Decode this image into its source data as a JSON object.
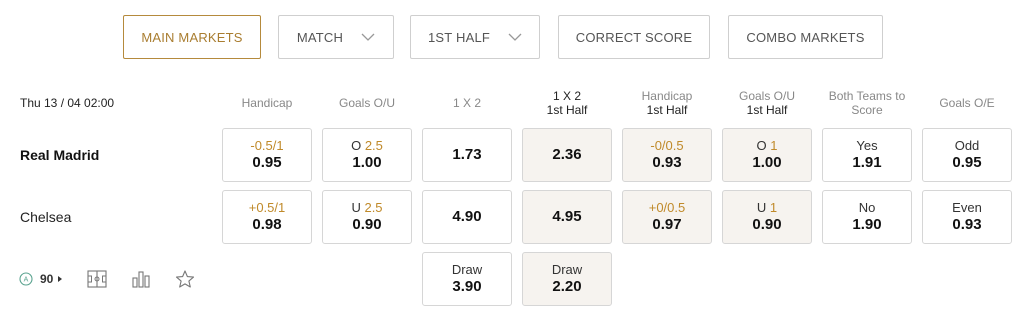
{
  "tabs": [
    {
      "label": "MAIN MARKETS",
      "active": true,
      "dropdown": false
    },
    {
      "label": "MATCH",
      "active": false,
      "dropdown": true
    },
    {
      "label": "1ST HALF",
      "active": false,
      "dropdown": true
    },
    {
      "label": "CORRECT SCORE",
      "active": false,
      "dropdown": false
    },
    {
      "label": "COMBO MARKETS",
      "active": false,
      "dropdown": false
    }
  ],
  "match": {
    "datetime": "Thu 13 / 04 02:00",
    "home": "Real Madrid",
    "away": "Chelsea",
    "markets_count": "90"
  },
  "headers": {
    "handicap": "Handicap",
    "goals_ou": "Goals O/U",
    "one_x_two": "1 X 2",
    "one_x_two_half_l1": "1 X 2",
    "one_x_two_half_l2": "1st Half",
    "handicap_half_l1": "Handicap",
    "handicap_half_l2": "1st Half",
    "goals_ou_half_l1": "Goals O/U",
    "goals_ou_half_l2": "1st Half",
    "btts_l1": "Both Teams to",
    "btts_l2": "Score",
    "goals_oe": "Goals O/E"
  },
  "odds": {
    "home": {
      "handicap": {
        "line": "-0.5/1",
        "odd": "0.95"
      },
      "goals_ou": {
        "side": "O",
        "line": "2.5",
        "odd": "1.00"
      },
      "one_x_two": {
        "odd": "1.73"
      },
      "one_x_two_half": {
        "odd": "2.36"
      },
      "handicap_half": {
        "line": "-0/0.5",
        "odd": "0.93"
      },
      "goals_ou_half": {
        "side": "O",
        "line": "1",
        "odd": "1.00"
      },
      "btts": {
        "label": "Yes",
        "odd": "1.91"
      },
      "goals_oe": {
        "label": "Odd",
        "odd": "0.95"
      }
    },
    "away": {
      "handicap": {
        "line": "+0.5/1",
        "odd": "0.98"
      },
      "goals_ou": {
        "side": "U",
        "line": "2.5",
        "odd": "0.90"
      },
      "one_x_two": {
        "odd": "4.90"
      },
      "one_x_two_half": {
        "odd": "4.95"
      },
      "handicap_half": {
        "line": "+0/0.5",
        "odd": "0.97"
      },
      "goals_ou_half": {
        "side": "U",
        "line": "1",
        "odd": "0.90"
      },
      "btts": {
        "label": "No",
        "odd": "1.90"
      },
      "goals_oe": {
        "label": "Even",
        "odd": "0.93"
      }
    },
    "draw": {
      "one_x_two": {
        "label": "Draw",
        "odd": "3.90"
      },
      "one_x_two_half": {
        "label": "Draw",
        "odd": "2.20"
      }
    }
  },
  "footer_icons": [
    "live-indicator-icon",
    "pitch-icon",
    "stats-icon",
    "favorite-star-icon"
  ],
  "colors": {
    "accent": "#b58a3c",
    "line": "#c08a2a",
    "shade": "#f6f3ef",
    "border": "#d6d6d6"
  }
}
